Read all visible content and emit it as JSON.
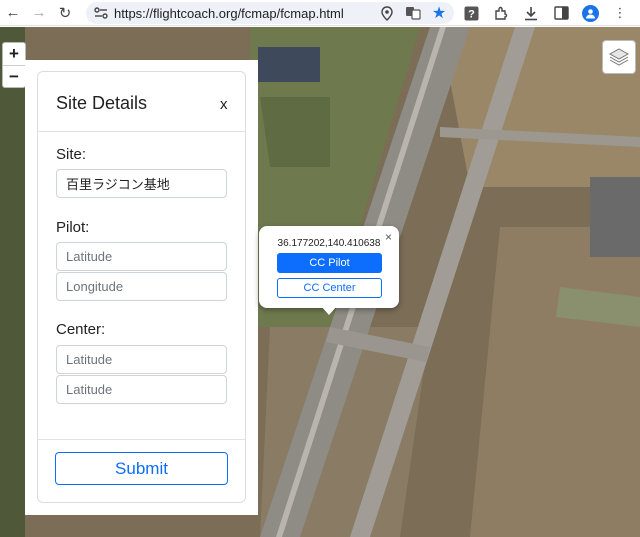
{
  "browser": {
    "url": "https://flightcoach.org/fcmap/fcmap.html"
  },
  "map": {
    "zoom_in": "+",
    "zoom_out": "−"
  },
  "panel": {
    "title": "Site Details",
    "close": "x",
    "site_label": "Site:",
    "site_value": "百里ラジコン基地",
    "pilot_label": "Pilot:",
    "pilot_lat_placeholder": "Latitude",
    "pilot_lon_placeholder": "Longitude",
    "center_label": "Center:",
    "center_lat_placeholder": "Latitude",
    "center_lon_placeholder": "Latitude",
    "submit": "Submit"
  },
  "popup": {
    "coords": "36.177202,140.410638",
    "close": "×",
    "pilot_button": "CC Pilot",
    "center_button": "CC Center"
  },
  "colors": {
    "primary": "#0d6efd",
    "star": "#1a73e8"
  }
}
